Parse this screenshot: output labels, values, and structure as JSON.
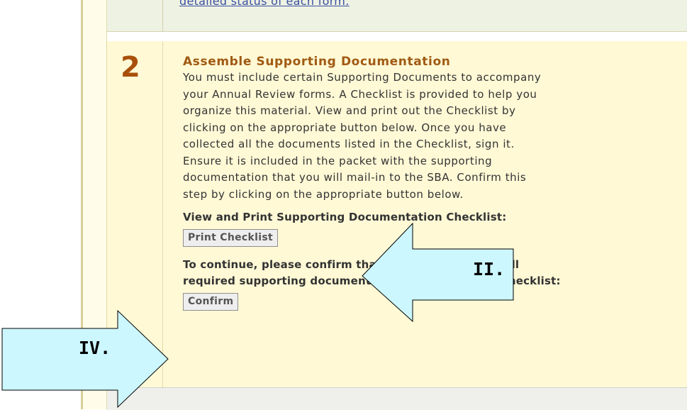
{
  "previous_step": {
    "link_text": "detailed status of each form."
  },
  "step": {
    "number": "2",
    "title": "Assemble Supporting Documentation",
    "description": "You must include certain Supporting Documents to accompany\nyour Annual Review forms. A Checklist is provided to help you\norganize this material. View and print out the Checklist by\nclicking on the appropriate button below. Once you have\ncollected all the documents listed in the Checklist, sign it.\nEnsure it is included in the packet with the supporting\ndocumentation that you will mail-in to the SBA. Confirm this\nstep by clicking on the appropriate button below.",
    "print_label": "View and Print Supporting Documentation Checklist:",
    "print_button": "Print Checklist",
    "confirm_label_line1": "To continue, please confirm that you have collected all",
    "confirm_label_line2": "required supporting documentation and signed the checklist:",
    "confirm_button": "Confirm"
  },
  "callouts": {
    "right_arrow_label": "IV.",
    "left_arrow_label": "II.",
    "fill_color": "#ccf7ff",
    "stroke_color": "#000000"
  }
}
